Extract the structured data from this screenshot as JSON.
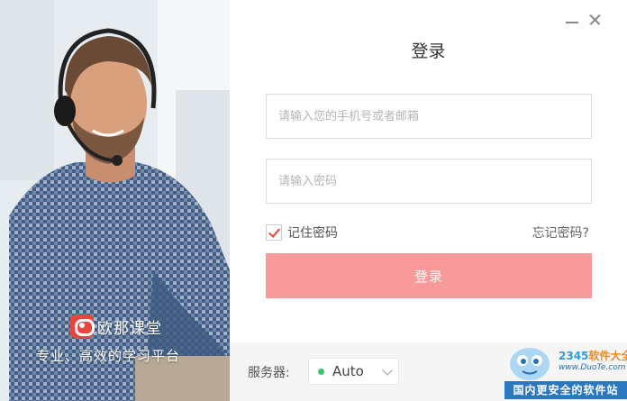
{
  "promo": {
    "brand_name": "欧那课堂",
    "slogan": "专业、高效的学习平台"
  },
  "login": {
    "title": "登录",
    "account_placeholder": "请输入您的手机号或者邮箱",
    "password_placeholder": "请输入密码",
    "remember_label": "记住密码",
    "remember_checked": true,
    "forgot_link": "忘记密码?",
    "submit_label": "登录",
    "submit_color": "#f99a9a",
    "accent_color": "#e8453c"
  },
  "server": {
    "label": "服务器:",
    "value": "Auto",
    "status_color": "#3cc36b"
  },
  "watermark": {
    "brand_prefix": "2345",
    "brand_suffix": "软件大全",
    "url": "www.DuoTe.com",
    "tagline": "国内更安全的软件站"
  }
}
